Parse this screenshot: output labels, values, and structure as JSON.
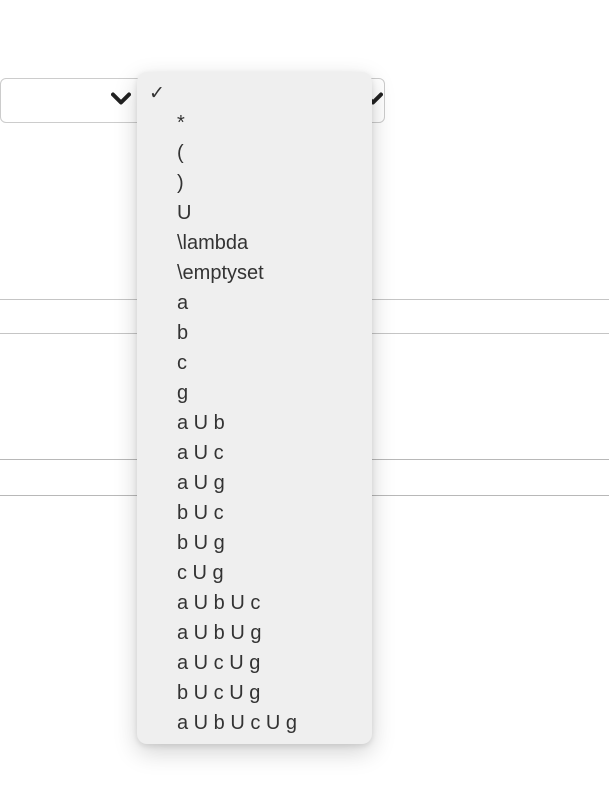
{
  "top_fragment": "",
  "selected_index": 0,
  "options": [
    {
      "label": ""
    },
    {
      "label": "*"
    },
    {
      "label": "("
    },
    {
      "label": ")"
    },
    {
      "label": "U"
    },
    {
      "label": "\\lambda"
    },
    {
      "label": "\\emptyset"
    },
    {
      "label": "a"
    },
    {
      "label": "b"
    },
    {
      "label": "c"
    },
    {
      "label": "g"
    },
    {
      "label": "a U b"
    },
    {
      "label": "a U c"
    },
    {
      "label": "a U g"
    },
    {
      "label": "b U c"
    },
    {
      "label": "b U g"
    },
    {
      "label": "c U g"
    },
    {
      "label": "a U b U c"
    },
    {
      "label": "a U b U g"
    },
    {
      "label": "a U c U g"
    },
    {
      "label": "b U c U g"
    },
    {
      "label": "a U b U c U g"
    }
  ],
  "icons": {
    "check": "✓"
  }
}
